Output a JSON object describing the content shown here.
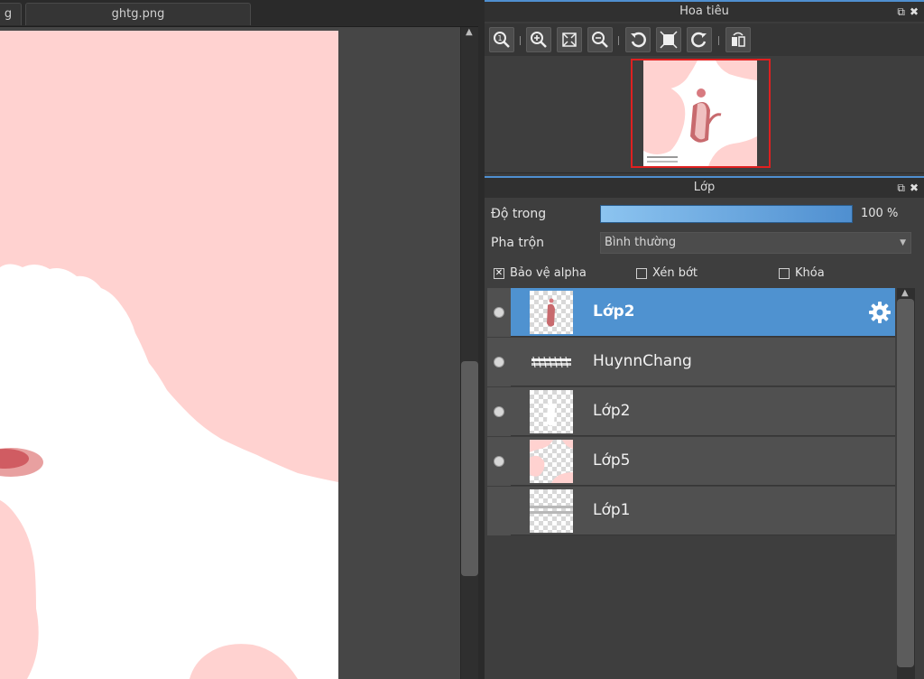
{
  "tabs": [
    {
      "label": "g"
    },
    {
      "label": "ghtg.png"
    }
  ],
  "navigator": {
    "title": "Hoa tiêu",
    "tools": [
      "zoom-actual-icon",
      "zoom-in-icon",
      "fit-screen-icon",
      "zoom-out-icon",
      "rotate-left-icon",
      "reset-view-icon",
      "rotate-right-icon",
      "flip-horizontal-icon"
    ]
  },
  "layers_panel": {
    "title": "Lớp",
    "opacity_label": "Độ trong",
    "opacity_value": "100 %",
    "opacity_fraction": 1.0,
    "blend_label": "Pha trộn",
    "blend_value": "Bình thường",
    "checkboxes": [
      {
        "label": "Bảo vệ alpha",
        "checked": true
      },
      {
        "label": "Xén bớt",
        "checked": false
      },
      {
        "label": "Khóa",
        "checked": false
      }
    ],
    "layers": [
      {
        "name": "Lớp2",
        "visible": true,
        "selected": true
      },
      {
        "name": "HuynnChang",
        "visible": true,
        "selected": false
      },
      {
        "name": "Lớp2",
        "visible": true,
        "selected": false
      },
      {
        "name": "Lớp5",
        "visible": true,
        "selected": false
      },
      {
        "name": "Lớp1",
        "visible": false,
        "selected": false
      }
    ]
  },
  "colors": {
    "accent": "#4f92d0",
    "canvas_pink": "#ffd2d0",
    "nav_frame": "#e02020"
  }
}
